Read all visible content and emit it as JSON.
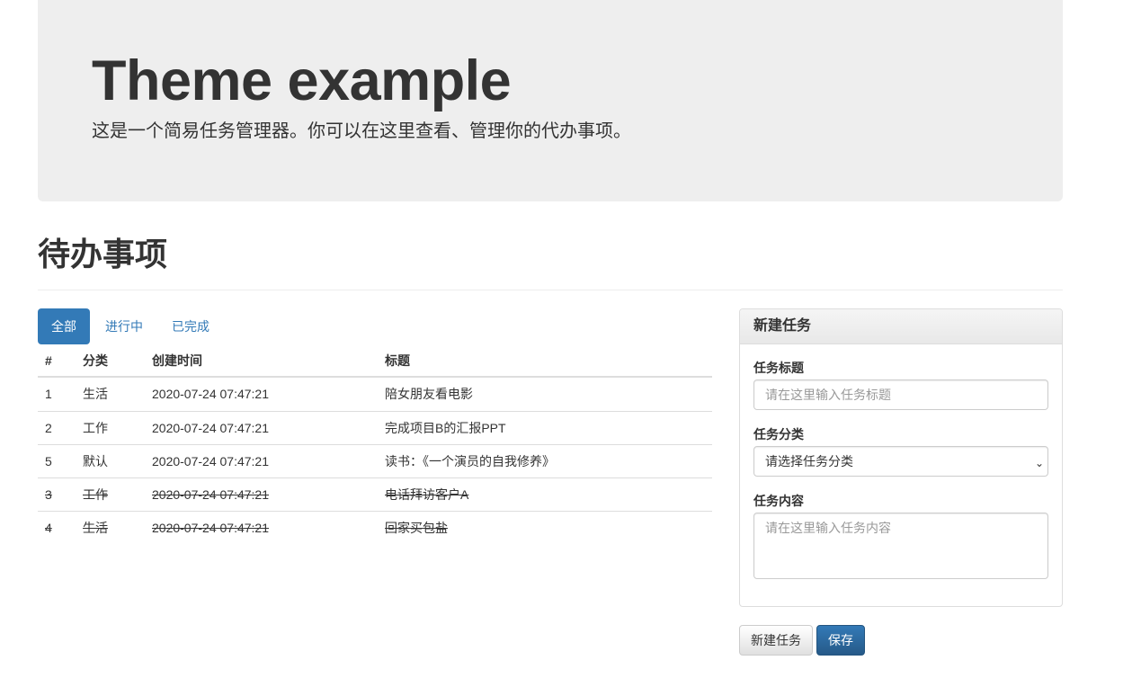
{
  "jumbotron": {
    "title": "Theme example",
    "subtitle": "这是一个简易任务管理器。你可以在这里查看、管理你的代办事项。"
  },
  "page": {
    "title": "待办事项"
  },
  "tabs": [
    {
      "label": "全部",
      "active": true
    },
    {
      "label": "进行中",
      "active": false
    },
    {
      "label": "已完成",
      "active": false
    }
  ],
  "table": {
    "headers": {
      "id": "#",
      "category": "分类",
      "created": "创建时间",
      "title": "标题"
    },
    "rows": [
      {
        "id": "1",
        "category": "生活",
        "created": "2020-07-24 07:47:21",
        "title": "陪女朋友看电影",
        "done": false
      },
      {
        "id": "2",
        "category": "工作",
        "created": "2020-07-24 07:47:21",
        "title": "完成项目B的汇报PPT",
        "done": false
      },
      {
        "id": "5",
        "category": "默认",
        "created": "2020-07-24 07:47:21",
        "title": "读书：《一个演员的自我修养》",
        "done": false
      },
      {
        "id": "3",
        "category": "工作",
        "created": "2020-07-24 07:47:21",
        "title": "电话拜访客户A",
        "done": true
      },
      {
        "id": "4",
        "category": "生活",
        "created": "2020-07-24 07:47:21",
        "title": "回家买包盐",
        "done": true
      }
    ]
  },
  "form": {
    "heading": "新建任务",
    "title_label": "任务标题",
    "title_placeholder": "请在这里输入任务标题",
    "title_value": "",
    "category_label": "任务分类",
    "category_selected": "请选择任务分类",
    "content_label": "任务内容",
    "content_placeholder": "请在这里输入任务内容",
    "content_value": ""
  },
  "buttons": {
    "new_task": "新建任务",
    "save": "保存"
  },
  "colors": {
    "primary": "#337ab7",
    "jumbotron_bg": "#eeeeee",
    "text": "#333333"
  }
}
